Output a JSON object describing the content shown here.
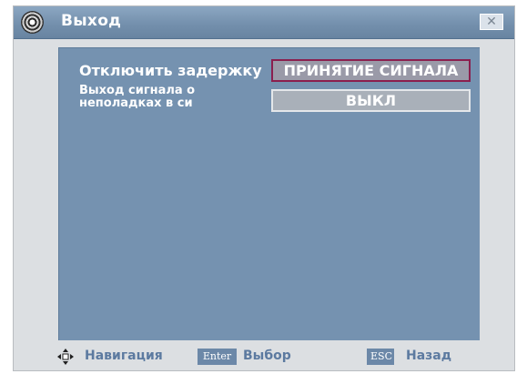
{
  "window": {
    "title": "Выход",
    "close_label": "✕"
  },
  "settings": [
    {
      "label": "Отключить задержку",
      "value": "ПРИНЯТИЕ СИГНАЛА"
    },
    {
      "label_line1": "Выход сигнала о",
      "label_line2": "неполадках в си",
      "value": "ВЫКЛ"
    }
  ],
  "footer": {
    "navigation_label": "Навигация",
    "enter_key": "Enter",
    "select_label": "Выбор",
    "esc_key": "ESC",
    "back_label": "Назад"
  },
  "colors": {
    "title_bar": "#7490ad",
    "content_panel": "#7592b0",
    "focused_border": "#8b1f4e",
    "footer_text": "#5c7aa0"
  },
  "icons": {
    "app": "satellite-dish-icon",
    "navigation": "four-way-arrow-icon"
  }
}
